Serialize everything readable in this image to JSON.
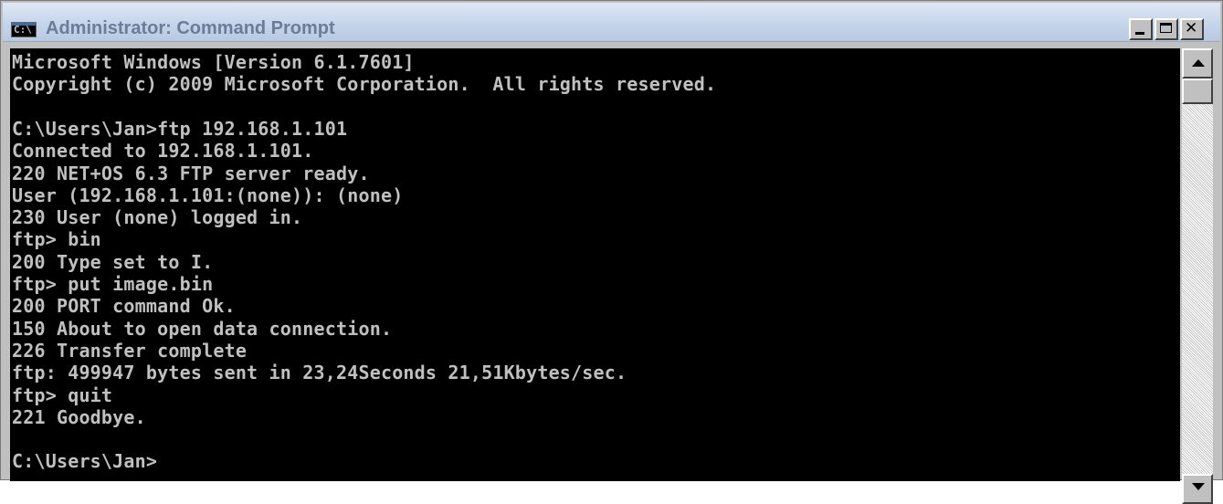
{
  "window": {
    "title": "Administrator: Command Prompt",
    "icon_text": "C:\\",
    "icon": "console-icon"
  },
  "controls": {
    "minimize_icon": "minimize-icon",
    "maximize_icon": "maximize-icon",
    "close_icon": "close-icon",
    "close_glyph": "✕"
  },
  "console": {
    "lines": [
      "Microsoft Windows [Version 6.1.7601]",
      "Copyright (c) 2009 Microsoft Corporation.  All rights reserved.",
      "",
      "C:\\Users\\Jan>ftp 192.168.1.101",
      "Connected to 192.168.1.101.",
      "220 NET+OS 6.3 FTP server ready.",
      "User (192.168.1.101:(none)): (none)",
      "230 User (none) logged in.",
      "ftp> bin",
      "200 Type set to I.",
      "ftp> put image.bin",
      "200 PORT command Ok.",
      "150 About to open data connection.",
      "226 Transfer complete",
      "ftp: 499947 bytes sent in 23,24Seconds 21,51Kbytes/sec.",
      "ftp> quit",
      "221 Goodbye.",
      "",
      "C:\\Users\\Jan>"
    ],
    "text_color": "#c0c0c0",
    "background_color": "#000000"
  },
  "scrollbar": {
    "up_icon": "arrow-up-icon",
    "down_icon": "arrow-down-icon"
  }
}
